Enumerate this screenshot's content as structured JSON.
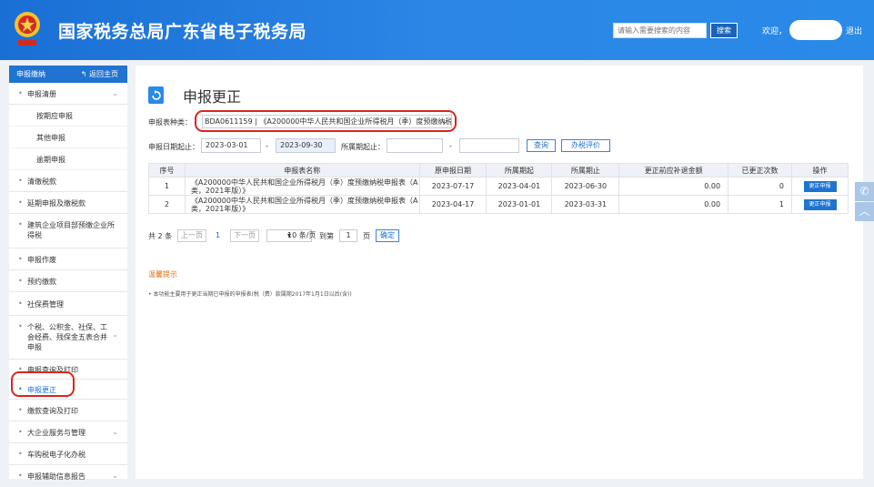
{
  "header": {
    "site_title": "国家税务总局广东省电子税务局",
    "search_placeholder": "请输入需要搜索的内容",
    "search_button": "搜索",
    "welcome": "欢迎，",
    "logout": "退出"
  },
  "sidebar": {
    "head_label": "申报缴纳",
    "back_label": "返回主页",
    "items": [
      {
        "label": "申报清册",
        "expandable": true
      },
      {
        "label": "按期应申报"
      },
      {
        "label": "其他申报"
      },
      {
        "label": "逾期申报"
      },
      {
        "label": "清缴税款"
      },
      {
        "label": "延期申报及缴税款"
      },
      {
        "label": "建筑企业项目部预缴企业所得税"
      },
      {
        "label": "申报作废"
      },
      {
        "label": "预约缴款"
      },
      {
        "label": "社保费管理"
      },
      {
        "label": "个税、公积金、社保、工会经费、残保金五表合并申报",
        "expandable": true
      },
      {
        "label": "申报查询及打印"
      },
      {
        "label": "申报更正"
      },
      {
        "label": "缴款查询及打印"
      },
      {
        "label": "大企业服务与管理",
        "expandable": true
      },
      {
        "label": "车购税电子化办税"
      },
      {
        "label": "申报辅助信息报告",
        "expandable": true
      }
    ]
  },
  "main": {
    "title": "申报更正",
    "form": {
      "type_label": "申报表种类：",
      "type_value": "BDA0611159 | 《A200000中华人民共和国企业所得税月（季）度预缴纳税",
      "date_label": "申报日期起止：",
      "date_from": "2023-03-01",
      "date_sep": "-",
      "date_to": "2023-09-30",
      "period_label": "所属期起止：",
      "period_sep": "-",
      "query_button": "查询",
      "eval_button": "办税评价"
    },
    "table": {
      "headers": [
        "序号",
        "申报表名称",
        "原申报日期",
        "所属期起",
        "所属期止",
        "更正前应补退金额",
        "已更正次数",
        "操作"
      ],
      "rows": [
        {
          "no": "1",
          "name": "《A200000中华人民共和国企业所得税月（季）度预缴纳税申报表（A类，2021年版）》",
          "date": "2023-07-17",
          "from": "2023-04-01",
          "to": "2023-06-30",
          "amount": "0.00",
          "count": "0",
          "action": "更正申报"
        },
        {
          "no": "2",
          "name": "《A200000中华人民共和国企业所得税月（季）度预缴纳税申报表（A类，2021年版）》",
          "date": "2023-04-17",
          "from": "2023-01-01",
          "to": "2023-03-31",
          "amount": "0.00",
          "count": "1",
          "action": "更正申报"
        }
      ]
    },
    "pager": {
      "total": "共 2 条",
      "prev": "上一页",
      "page": "1",
      "next": "下一页",
      "page_size": "10 条/页",
      "goto_label": "到第",
      "goto_value": "1",
      "page_unit": "页",
      "confirm": "确定"
    },
    "tip_title": "温馨提示",
    "tip_text": "• 本功能主要用于更正当期已申报的申报表(税（费）款属期2017年1月1日以后(含))"
  },
  "colors": {
    "brand": "#1f73d1",
    "highlight": "#d9261c",
    "tip": "#e06a10"
  }
}
